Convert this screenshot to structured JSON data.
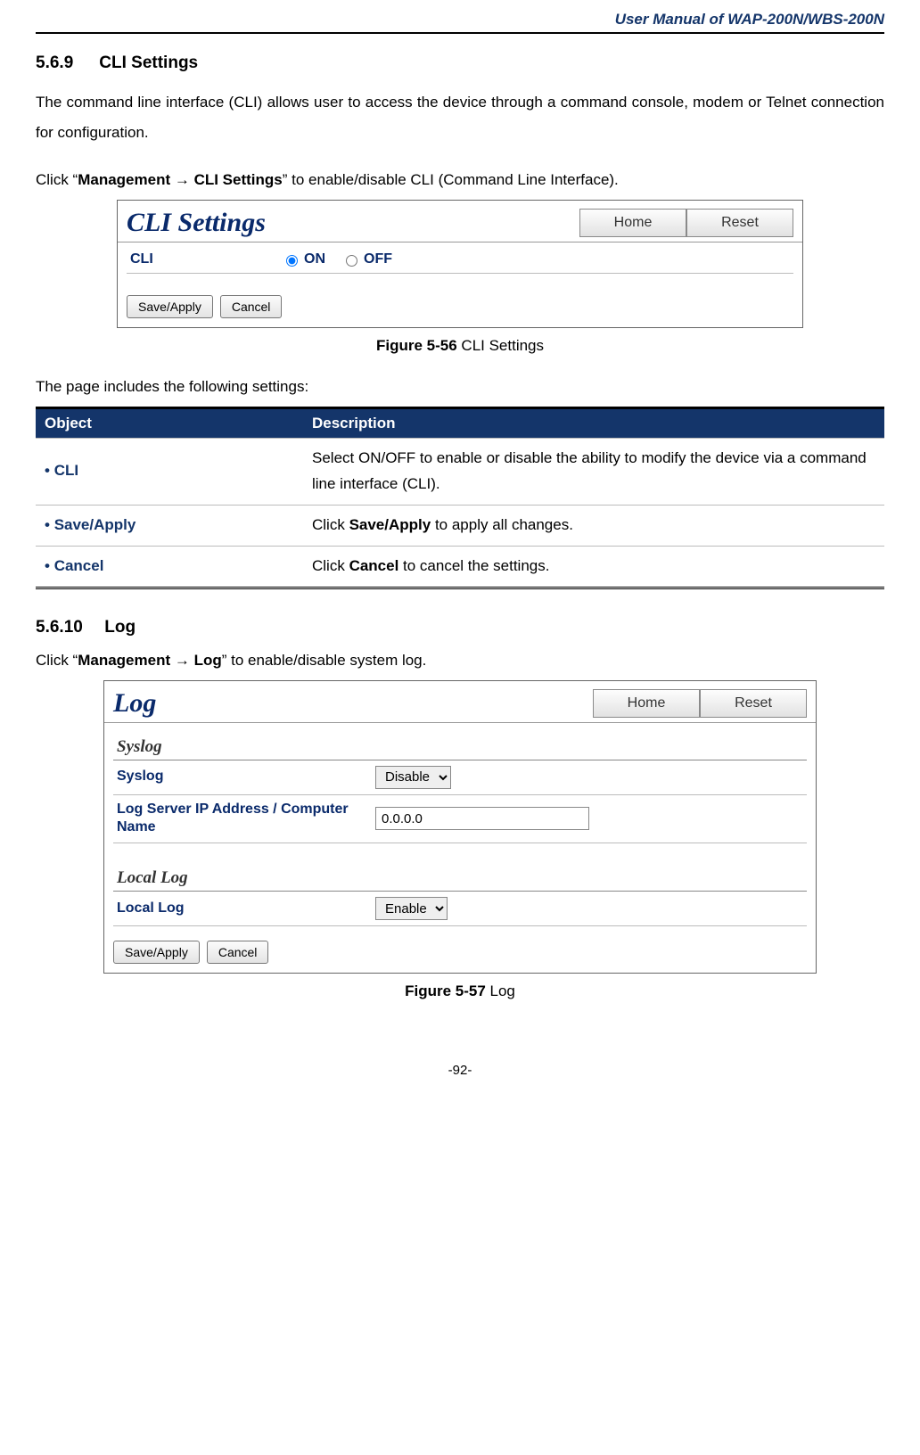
{
  "header": {
    "title": "User Manual of WAP-200N/WBS-200N"
  },
  "section1": {
    "num": "5.6.9",
    "title": "CLI Settings",
    "intro": "The command line interface (CLI) allows user to access the device through a command console, modem or Telnet connection for configuration.",
    "instr_prefix": "Click “",
    "instr_path": "Management → CLI Settings",
    "instr_suffix": "” to enable/disable CLI (Command Line Interface)."
  },
  "shot1": {
    "title": "CLI Settings",
    "home": "Home",
    "reset": "Reset",
    "cli_label": "CLI",
    "on": "ON",
    "off": "OFF",
    "save": "Save/Apply",
    "cancel": "Cancel"
  },
  "caption1": {
    "bold": "Figure 5-56",
    "text": " CLI Settings"
  },
  "table_intro": "The page includes the following settings:",
  "table": {
    "h1": "Object",
    "h2": "Description",
    "rows": [
      {
        "obj": "CLI",
        "desc": "Select ON/OFF to enable or disable the ability to modify the device via a command line interface (CLI)."
      },
      {
        "obj": "Save/Apply",
        "desc_pre": "Click ",
        "desc_bold": "Save/Apply",
        "desc_post": " to apply all changes."
      },
      {
        "obj": "Cancel",
        "desc_pre": "Click ",
        "desc_bold": "Cancel",
        "desc_post": " to cancel the settings."
      }
    ]
  },
  "section2": {
    "num": "5.6.10",
    "title": "Log",
    "instr_prefix": "Click “",
    "instr_path": "Management → Log",
    "instr_suffix": "” to enable/disable system log."
  },
  "shot2": {
    "title": "Log",
    "home": "Home",
    "reset": "Reset",
    "group1": "Syslog",
    "syslog_label": "Syslog",
    "syslog_value": "Disable",
    "ip_label": "Log Server IP Address / Computer Name",
    "ip_value": "0.0.0.0",
    "group2": "Local Log",
    "local_label": "Local Log",
    "local_value": "Enable",
    "save": "Save/Apply",
    "cancel": "Cancel"
  },
  "caption2": {
    "bold": "Figure 5-57",
    "text": " Log"
  },
  "footer": "-92-"
}
